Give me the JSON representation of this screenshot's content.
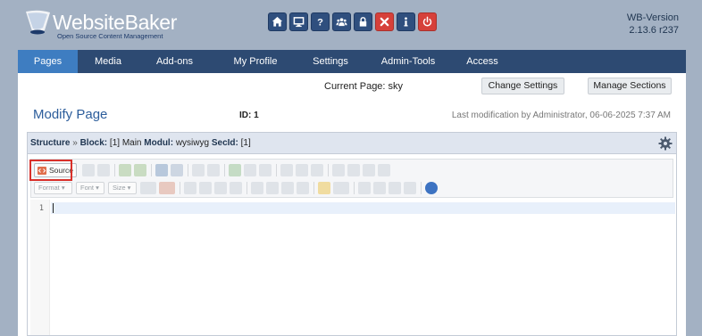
{
  "brand": {
    "title": "WebsiteBaker",
    "subtitle": "Open Source Content Management"
  },
  "top_icons": [
    {
      "name": "home-icon",
      "color": "#2f4f7e"
    },
    {
      "name": "monitor-icon",
      "color": "#2f4f7e"
    },
    {
      "name": "help-icon",
      "color": "#2f4f7e"
    },
    {
      "name": "users-icon",
      "color": "#2f4f7e"
    },
    {
      "name": "lock-icon",
      "color": "#2f4f7e"
    },
    {
      "name": "close-icon",
      "color": "#d6403a"
    },
    {
      "name": "info-icon",
      "color": "#2f4f7e"
    },
    {
      "name": "power-icon",
      "color": "#d6403a"
    }
  ],
  "version": {
    "label": "WB-Version",
    "number": "2.13.6 r237"
  },
  "menu": {
    "items": [
      "Pages",
      "Media",
      "Add-ons",
      "My Profile",
      "Settings",
      "Admin-Tools",
      "Access"
    ],
    "active": "Pages"
  },
  "page_header": {
    "current_page_label": "Current Page:",
    "current_page_value": "sky",
    "change_settings": "Change Settings",
    "manage_sections": "Manage Sections",
    "title": "Modify Page",
    "id_label": "ID: 1",
    "last_modification": "Last modification by Administrator, 06-06-2025 7:37 AM"
  },
  "section": {
    "structure_label": "Structure",
    "separator": "»",
    "block_label": "Block:",
    "block_value": "[1] Main",
    "modul_label": "Modul:",
    "modul_value": "wysiwyg",
    "secid_label": "SecId:",
    "secid_value": "[1]"
  },
  "editor": {
    "source_label": "Source",
    "format_combo": "Format",
    "font_combo": "Font",
    "size_combo": "Size",
    "line_number": "1"
  },
  "colors": {
    "background": "#a3b1c3",
    "menubar": "#2d4a72",
    "menu_active": "#3e7dc1",
    "title": "#2c5d9b",
    "highlight": "#d9302a"
  }
}
